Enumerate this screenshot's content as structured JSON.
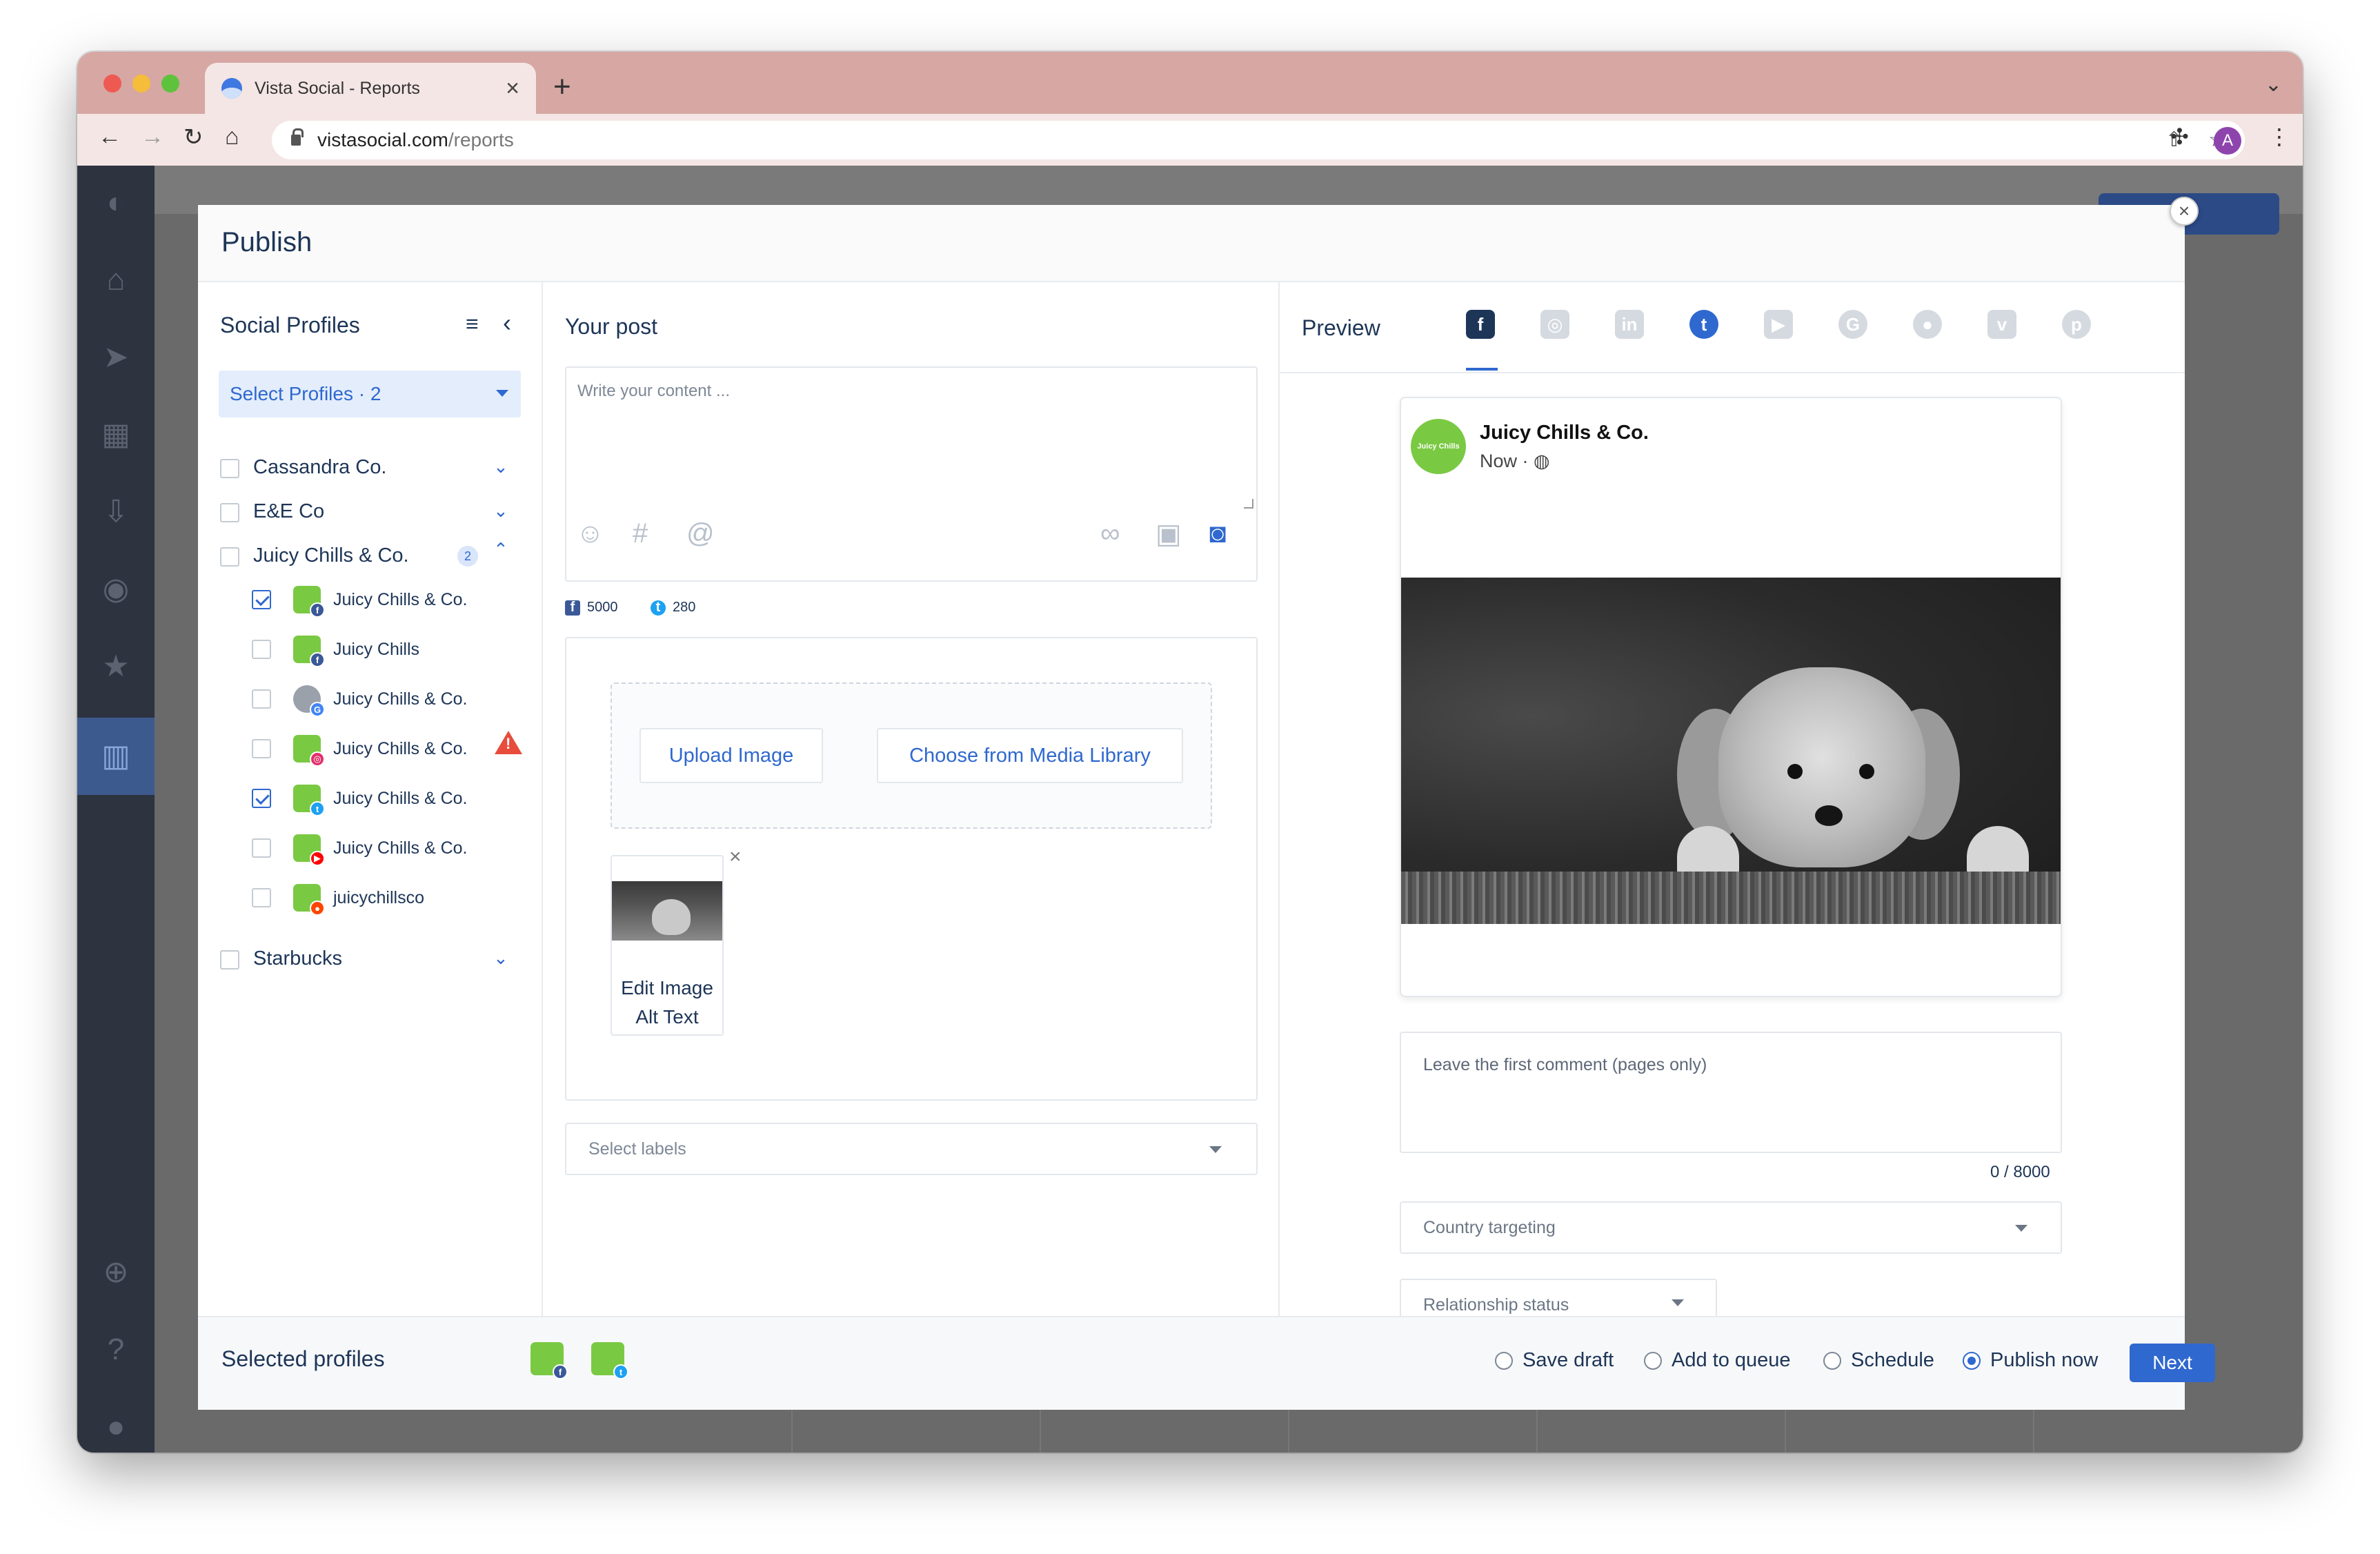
{
  "browser": {
    "tab_title": "Vista Social - Reports",
    "url_host": "vistasocial.com",
    "url_path": "/reports",
    "profile_initial": "A"
  },
  "modal": {
    "title": "Publish",
    "close_icon": "×"
  },
  "social_profiles": {
    "title": "Social Profiles",
    "select_label": "Select Profiles · 2",
    "groups": [
      {
        "name": "Cassandra Co.",
        "expanded": false
      },
      {
        "name": "E&E Co",
        "expanded": false
      },
      {
        "name": "Juicy Chills & Co.",
        "expanded": true,
        "badge": "2"
      },
      {
        "name": "Starbucks",
        "expanded": false
      }
    ],
    "profiles": [
      {
        "name": "Juicy Chills & Co.",
        "network": "facebook",
        "checked": true
      },
      {
        "name": "Juicy Chills",
        "network": "facebook",
        "checked": false
      },
      {
        "name": "Juicy Chills & Co.",
        "network": "google",
        "checked": false
      },
      {
        "name": "Juicy Chills & Co.",
        "network": "instagram",
        "checked": false,
        "warning": true
      },
      {
        "name": "Juicy Chills & Co.",
        "network": "twitter",
        "checked": true
      },
      {
        "name": "Juicy Chills & Co.",
        "network": "youtube",
        "checked": false
      },
      {
        "name": "juicychillsco",
        "network": "reddit",
        "checked": false
      }
    ]
  },
  "post": {
    "title": "Your post",
    "placeholder": "Write your content ...",
    "limits": {
      "facebook": "5000",
      "twitter": "280"
    },
    "upload_label": "Upload Image",
    "library_label": "Choose from Media Library",
    "alt_text_label": "Edit Image Alt Text",
    "labels_placeholder": "Select labels"
  },
  "preview": {
    "title": "Preview",
    "networks": [
      "facebook",
      "instagram",
      "linkedin",
      "twitter",
      "youtube",
      "google",
      "reddit",
      "vimeo",
      "pinterest"
    ],
    "active_network": "facebook",
    "post_author": "Juicy Chills & Co.",
    "post_time": "Now · ",
    "avatar_text": "Juicy Chills",
    "comment_placeholder": "Leave the first comment (pages only)",
    "char_count": "0 / 8000",
    "country_placeholder": "Country targeting",
    "relationship_placeholder": "Relationship status"
  },
  "footer": {
    "selected_label": "Selected profiles",
    "options": [
      "Save draft",
      "Add to queue",
      "Schedule",
      "Publish now"
    ],
    "selected_option": "Publish now",
    "next_label": "Next"
  },
  "colors": {
    "accent": "#2f68cf",
    "heading": "#1d3557",
    "brand_green": "#7ac943",
    "warning": "#e74c3c"
  }
}
